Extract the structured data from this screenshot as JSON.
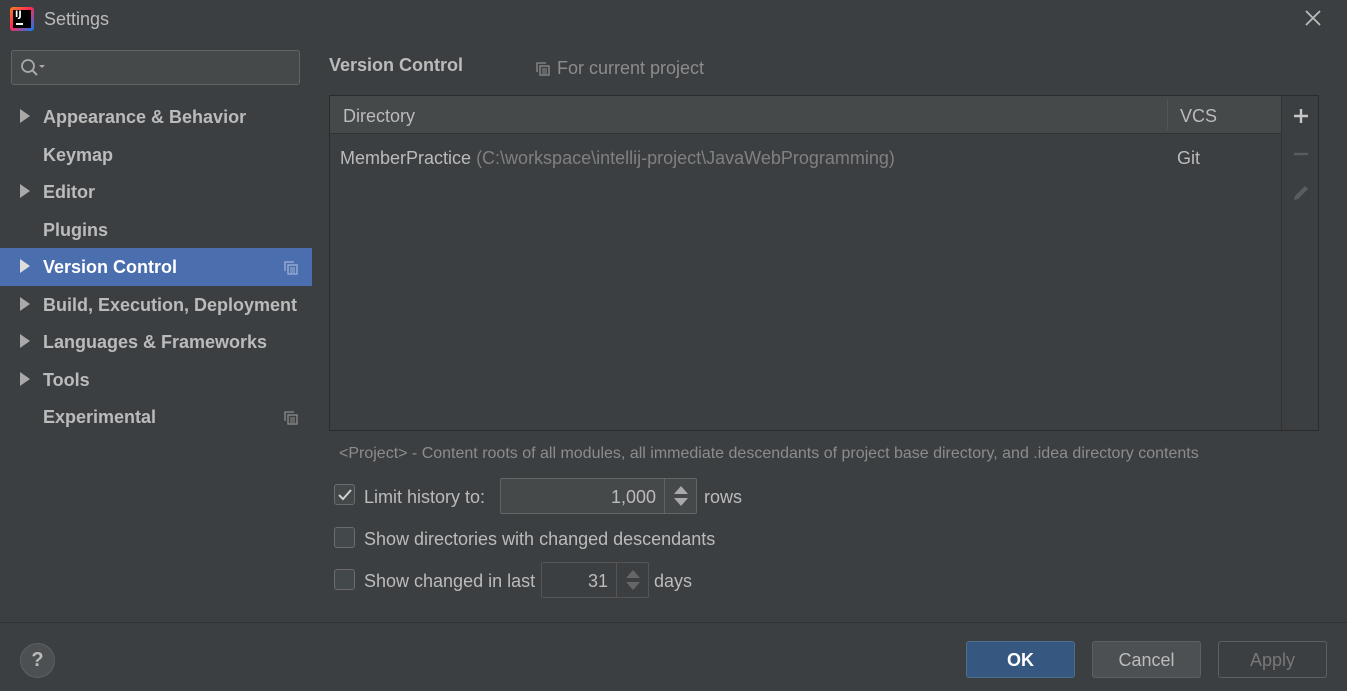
{
  "window": {
    "title": "Settings",
    "logo_text": "IJ"
  },
  "sidebar": {
    "search": {
      "value": "",
      "placeholder": ""
    },
    "items": [
      {
        "label": "Appearance & Behavior",
        "expandable": true,
        "selected": false,
        "project_scope": false
      },
      {
        "label": "Keymap",
        "expandable": false,
        "selected": false,
        "project_scope": false
      },
      {
        "label": "Editor",
        "expandable": true,
        "selected": false,
        "project_scope": false
      },
      {
        "label": "Plugins",
        "expandable": false,
        "selected": false,
        "project_scope": false
      },
      {
        "label": "Version Control",
        "expandable": true,
        "selected": true,
        "project_scope": true
      },
      {
        "label": "Build, Execution, Deployment",
        "expandable": true,
        "selected": false,
        "project_scope": false
      },
      {
        "label": "Languages & Frameworks",
        "expandable": true,
        "selected": false,
        "project_scope": false
      },
      {
        "label": "Tools",
        "expandable": true,
        "selected": false,
        "project_scope": false
      },
      {
        "label": "Experimental",
        "expandable": false,
        "selected": false,
        "project_scope": true
      }
    ]
  },
  "main": {
    "title": "Version Control",
    "scope_hint": "For current project",
    "table": {
      "columns": [
        "Directory",
        "VCS"
      ],
      "rows": [
        {
          "name": "MemberPractice",
          "path": "(C:\\workspace\\intellij-project\\JavaWebProgramming)",
          "vcs": "Git"
        }
      ]
    },
    "toolbar": [
      "add-icon",
      "remove-icon",
      "edit-icon"
    ],
    "note": "<Project> - Content roots of all modules, all immediate descendants of project base directory, and .idea directory contents",
    "options": {
      "limit_history": {
        "checked": true,
        "label": "Limit history to:",
        "value": "1,000",
        "suffix": "rows"
      },
      "show_dirs": {
        "checked": false,
        "label": "Show directories with changed descendants"
      },
      "show_changed": {
        "checked": false,
        "label": "Show changed in last",
        "value": "31",
        "suffix": "days"
      }
    }
  },
  "footer": {
    "help": "?",
    "ok": "OK",
    "cancel": "Cancel",
    "apply": "Apply"
  },
  "colors": {
    "background": "#3c3f41",
    "selection": "#4b6eaf",
    "ok_button": "#365880",
    "text": "#bbbbbb"
  }
}
